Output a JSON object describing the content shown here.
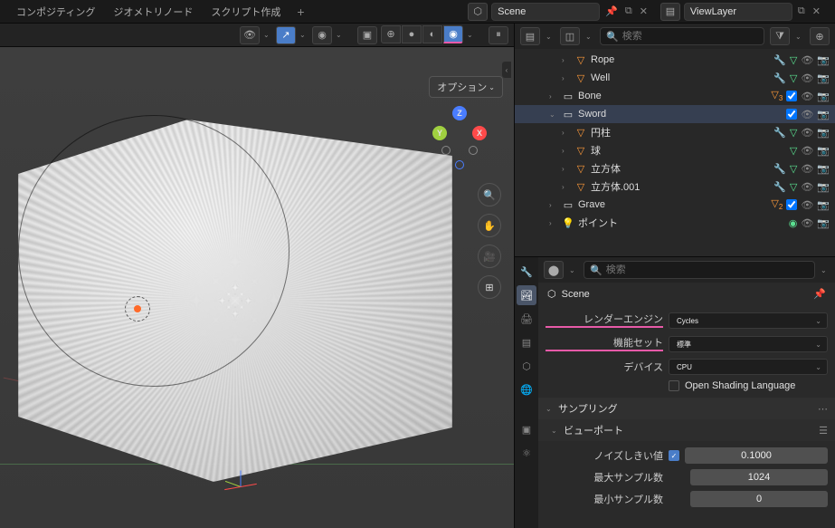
{
  "tabs": {
    "compositing": "コンポジティング",
    "geometry": "ジオメトリノード",
    "scripting": "スクリプト作成"
  },
  "header": {
    "scene_name": "Scene",
    "layer_name": "ViewLayer"
  },
  "viewport": {
    "options_label": "オプション",
    "gizmo": {
      "z": "Z",
      "x": "X",
      "y": "Y"
    }
  },
  "outliner": {
    "search_placeholder": "検索",
    "items": [
      {
        "name": "Rope",
        "type": "mesh",
        "indent": 3,
        "mods": [
          "wrench",
          "tri"
        ],
        "vis": [
          "eye",
          "cam"
        ]
      },
      {
        "name": "Well",
        "type": "mesh",
        "indent": 3,
        "mods": [
          "wrench",
          "tri"
        ],
        "vis": [
          "eye",
          "cam"
        ]
      },
      {
        "name": "Bone",
        "type": "coll",
        "indent": 2,
        "badge": "3",
        "check": true,
        "vis": [
          "eye",
          "cam"
        ]
      },
      {
        "name": "Sword",
        "type": "coll",
        "indent": 2,
        "expanded": true,
        "selected": true,
        "check": true,
        "vis": [
          "eye",
          "cam"
        ]
      },
      {
        "name": "円柱",
        "type": "mesh",
        "indent": 3,
        "mods": [
          "wrench",
          "tri"
        ],
        "vis": [
          "eye",
          "cam"
        ]
      },
      {
        "name": "球",
        "type": "mesh",
        "indent": 3,
        "mods": [
          "tri"
        ],
        "vis": [
          "eye",
          "cam"
        ]
      },
      {
        "name": "立方体",
        "type": "mesh",
        "indent": 3,
        "mods": [
          "wrench",
          "tri"
        ],
        "vis": [
          "eye",
          "cam"
        ]
      },
      {
        "name": "立方体.001",
        "type": "mesh",
        "indent": 3,
        "mods": [
          "wrench",
          "tri"
        ],
        "vis": [
          "eye",
          "cam"
        ]
      },
      {
        "name": "Grave",
        "type": "coll",
        "indent": 2,
        "badge": "2",
        "check": true,
        "vis": [
          "eye",
          "cam"
        ]
      },
      {
        "name": "ポイント",
        "type": "light",
        "indent": 2,
        "vis": [
          "eye",
          "cam"
        ]
      }
    ]
  },
  "properties": {
    "search_placeholder": "検索",
    "breadcrumb": "Scene",
    "render_engine_label": "レンダーエンジン",
    "render_engine_value": "Cycles",
    "feature_set_label": "機能セット",
    "feature_set_value": "標準",
    "device_label": "デバイス",
    "device_value": "CPU",
    "osl_label": "Open Shading Language",
    "sampling_label": "サンプリング",
    "viewport_label": "ビューポート",
    "noise_threshold_label": "ノイズしきい値",
    "noise_threshold_value": "0.1000",
    "max_samples_label": "最大サンプル数",
    "max_samples_value": "1024",
    "min_samples_label": "最小サンプル数",
    "min_samples_value": "0"
  }
}
